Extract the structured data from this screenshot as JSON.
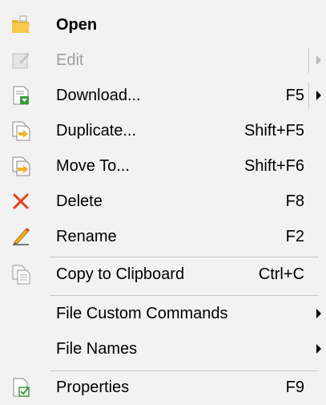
{
  "menu": {
    "items": [
      {
        "label": "Open",
        "shortcut": "",
        "icon": "folder-open-icon"
      },
      {
        "label": "Edit",
        "shortcut": "",
        "icon": "edit-icon"
      },
      {
        "label": "Download...",
        "shortcut": "F5",
        "icon": "download-icon"
      },
      {
        "label": "Duplicate...",
        "shortcut": "Shift+F5",
        "icon": "duplicate-icon"
      },
      {
        "label": "Move To...",
        "shortcut": "Shift+F6",
        "icon": "move-icon"
      },
      {
        "label": "Delete",
        "shortcut": "F8",
        "icon": "delete-icon"
      },
      {
        "label": "Rename",
        "shortcut": "F2",
        "icon": "rename-icon"
      },
      {
        "label": "Copy to Clipboard",
        "shortcut": "Ctrl+C",
        "icon": "clipboard-icon"
      },
      {
        "label": "File Custom Commands",
        "shortcut": "",
        "icon": ""
      },
      {
        "label": "File Names",
        "shortcut": "",
        "icon": ""
      },
      {
        "label": "Properties",
        "shortcut": "F9",
        "icon": "properties-icon"
      }
    ],
    "colors": {
      "background": "#f2f2f2",
      "disabled_text": "#a0a0a0",
      "separator": "#c9c9c9",
      "delete_red": "#e8401c",
      "folder_yellow": "#f7c94c",
      "action_green": "#3a9a3a"
    }
  }
}
